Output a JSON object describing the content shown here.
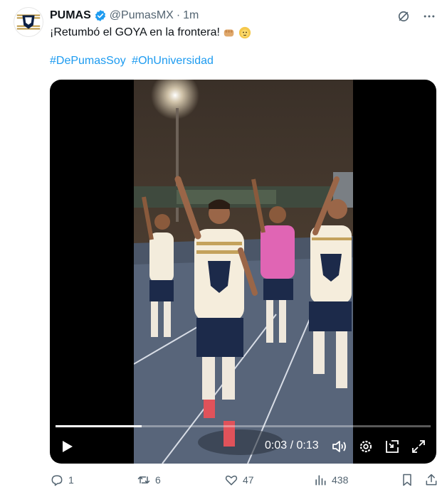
{
  "account": {
    "display_name": "PUMAS",
    "handle": "@PumasMX",
    "separator": "·",
    "time": "1m"
  },
  "tweet": {
    "text": "¡Retumbó el GOYA en la frontera!",
    "emojis": [
      "fist-icon",
      "lion-face-icon"
    ],
    "hashtags": [
      "#DePumasSoy",
      "#OhUniversidad"
    ]
  },
  "video": {
    "time_display": "0:03 / 0:13",
    "progress": 0.23
  },
  "actions": {
    "replies": "1",
    "retweets": "6",
    "likes": "47",
    "views": "438"
  },
  "colors": {
    "link": "#1d9bf0",
    "muted": "#536471",
    "verified": "#1d9bf0",
    "brand_gold": "#b8923a",
    "brand_navy": "#0a1f44"
  }
}
